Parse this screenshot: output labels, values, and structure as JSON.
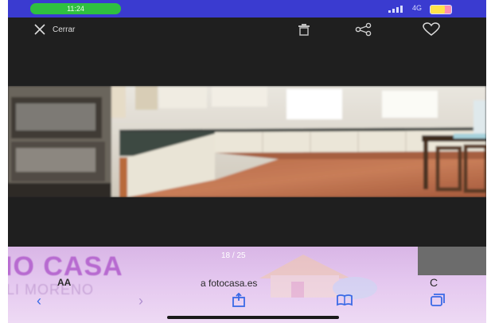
{
  "status_bar": {
    "time_pill": "11:24",
    "network": "4G",
    "battery_level": 0.7
  },
  "viewer": {
    "close_label": "Cerrar",
    "icons": {
      "close": "close-icon",
      "delete": "trash-icon",
      "share": "share-icon",
      "favorite": "heart-icon"
    },
    "photo_counter": "18 / 25"
  },
  "page": {
    "brand_title": "IO CASA",
    "brand_subtitle": "LI MORENO",
    "text_size_label": "AA",
    "address": "a fotocasa.es",
    "reload_glyph": "C"
  },
  "colors": {
    "status_bar": "#3a3bd0",
    "viewer_bg": "#1f1f1f",
    "accent_green": "#2fc040",
    "nav_blue": "#3a6ae6",
    "page_purple": "#b76ad0"
  }
}
